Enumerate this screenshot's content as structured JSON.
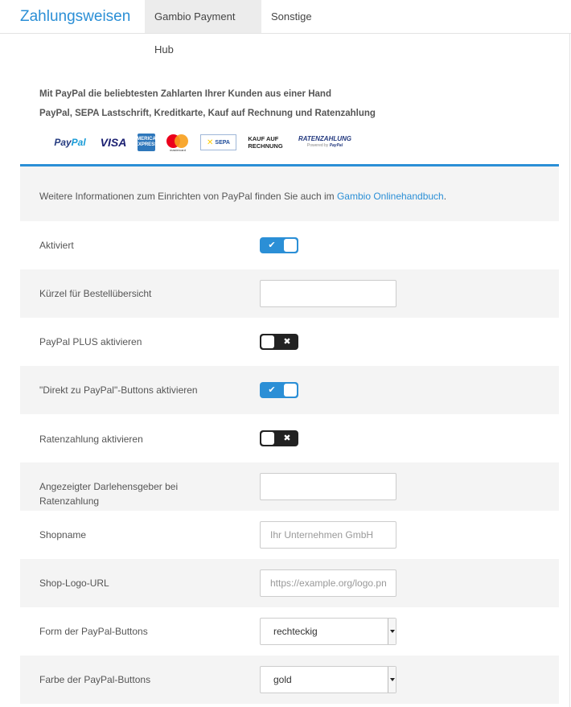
{
  "header": {
    "title": "Zahlungsweisen",
    "tabs": [
      {
        "label": "Gambio Payment Hub"
      },
      {
        "label": "Sonstige"
      }
    ]
  },
  "promo": {
    "line1": "Mit PayPal die beliebtesten Zahlarten Ihrer Kunden aus einer Hand",
    "line2": "PayPal, SEPA Lastschrift, Kreditkarte, Kauf auf Rechnung und Ratenzahlung",
    "logos": {
      "paypal_a": "Pay",
      "paypal_b": "Pal",
      "visa": "VISA",
      "amex": "AMERICAN EXPRESS",
      "mastercard": "mastercard",
      "sepa": "SEPA",
      "rechnung_1": "KAUF AUF",
      "rechnung_2": "RECHNUNG",
      "raten": "RATENZAHLUNG",
      "raten_powered": "Powered by",
      "raten_paypal": "PayPal"
    }
  },
  "info": {
    "text": "Weitere Informationen zum Einrichten von PayPal finden Sie auch im ",
    "link": "Gambio Onlinehandbuch",
    "suffix": "."
  },
  "settings": {
    "aktiviert": {
      "label": "Aktiviert",
      "enabled": true
    },
    "kuerzel": {
      "label": "Kürzel für Bestellübersicht",
      "value": ""
    },
    "plus": {
      "label": "PayPal PLUS aktivieren",
      "enabled": false
    },
    "direkt": {
      "label": "\"Direkt zu PayPal\"-Buttons aktivieren",
      "enabled": true
    },
    "raten": {
      "label": "Ratenzahlung aktivieren",
      "enabled": false
    },
    "darlehen": {
      "label": "Angezeigter Darlehensgeber bei Ratenzahlung",
      "value": ""
    },
    "shopname": {
      "label": "Shopname",
      "value": "",
      "placeholder": "Ihr Unternehmen GmbH"
    },
    "logo_url": {
      "label": "Shop-Logo-URL",
      "value": "",
      "placeholder": "https://example.org/logo.png"
    },
    "form": {
      "label": "Form der PayPal-Buttons",
      "value": "rechteckig"
    },
    "farbe": {
      "label": "Farbe der PayPal-Buttons",
      "value": "gold"
    }
  },
  "icons": {
    "check": "✔",
    "cross": "✖"
  },
  "colors": {
    "accent": "#2b8fd6",
    "toggle_off": "#222222",
    "row_alt": "#f4f4f4"
  }
}
